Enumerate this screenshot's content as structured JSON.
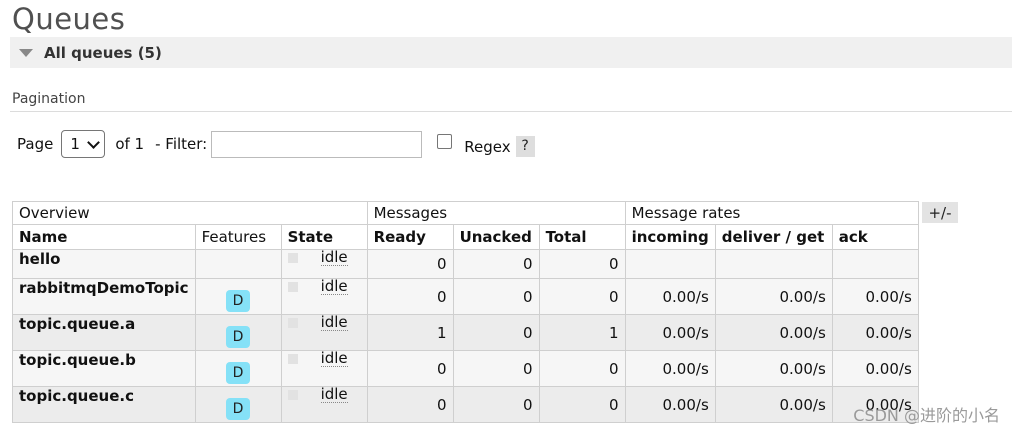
{
  "page": {
    "title": "Queues"
  },
  "section": {
    "label": "All queues (5)"
  },
  "pagination": {
    "label": "Pagination",
    "page_label": "Page",
    "page_value": "1",
    "of_label": "of 1",
    "filter_label": "- Filter:",
    "filter_value": "",
    "regex_label": "Regex",
    "help_label": "?"
  },
  "table": {
    "groups": {
      "overview": "Overview",
      "messages": "Messages",
      "rates": "Message rates"
    },
    "columns": {
      "name": "Name",
      "features": "Features",
      "state": "State",
      "ready": "Ready",
      "unacked": "Unacked",
      "total": "Total",
      "incoming": "incoming",
      "deliver": "deliver / get",
      "ack": "ack"
    },
    "toggle_label": "+/-",
    "rows": [
      {
        "name": "hello",
        "feature": "",
        "state": "idle",
        "ready": "0",
        "unacked": "0",
        "total": "0",
        "incoming": "",
        "deliver": "",
        "ack": ""
      },
      {
        "name": "rabbitmqDemoTopic",
        "feature": "D",
        "state": "idle",
        "ready": "0",
        "unacked": "0",
        "total": "0",
        "incoming": "0.00/s",
        "deliver": "0.00/s",
        "ack": "0.00/s"
      },
      {
        "name": "topic.queue.a",
        "feature": "D",
        "state": "idle",
        "ready": "1",
        "unacked": "0",
        "total": "1",
        "incoming": "0.00/s",
        "deliver": "0.00/s",
        "ack": "0.00/s"
      },
      {
        "name": "topic.queue.b",
        "feature": "D",
        "state": "idle",
        "ready": "0",
        "unacked": "0",
        "total": "0",
        "incoming": "0.00/s",
        "deliver": "0.00/s",
        "ack": "0.00/s"
      },
      {
        "name": "topic.queue.c",
        "feature": "D",
        "state": "idle",
        "ready": "0",
        "unacked": "0",
        "total": "0",
        "incoming": "0.00/s",
        "deliver": "0.00/s",
        "ack": "0.00/s"
      }
    ]
  },
  "watermark": "CSDN @进阶的小名",
  "colors": {
    "feature_badge": "#85e1f7",
    "row_bg": "#f6f6f6",
    "row_alt_bg": "#ececec"
  }
}
